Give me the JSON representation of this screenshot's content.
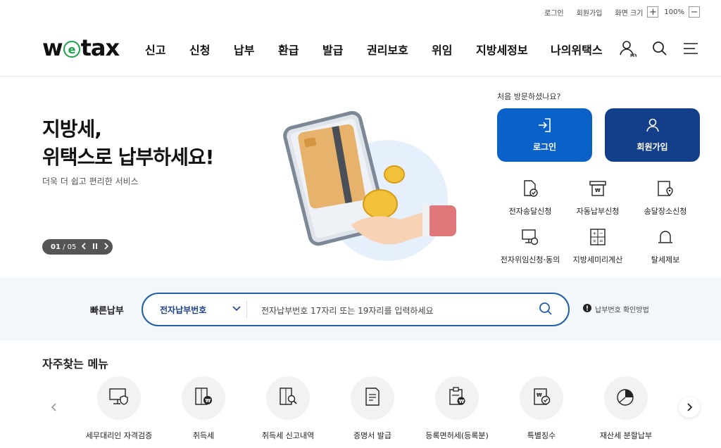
{
  "utility": {
    "login": "로그인",
    "signup": "회원가입",
    "zoom_label": "화면 크기",
    "zoom_in": "+",
    "zoom_value": "100%",
    "zoom_out": "−"
  },
  "logo": {
    "part1": "w",
    "part2": "e",
    "part3": "tax"
  },
  "nav": [
    "신고",
    "신청",
    "납부",
    "환급",
    "발급",
    "권리보호",
    "위임",
    "지방세정보",
    "나의위택스"
  ],
  "header_icons": {
    "my": "MY"
  },
  "hero": {
    "title_line1": "지방세,",
    "title_line2": "위택스로 납부하세요!",
    "subtitle": "더욱 더 쉽고 편리한 서비스",
    "pager_current": "01",
    "pager_total": "/ 05"
  },
  "panel": {
    "first_visit": "처음 방문하셨나요?",
    "login_btn": "로그인",
    "signup_btn": "회원가입",
    "login_color": "#0a62c9",
    "signup_color": "#133e8a",
    "services": [
      {
        "label": "전자송달신청",
        "icon": "document-check-icon"
      },
      {
        "label": "자동납부신청",
        "icon": "auto-pay-icon"
      },
      {
        "label": "송달장소신청",
        "icon": "location-doc-icon"
      },
      {
        "label": "전자위임신청·동의",
        "icon": "monitor-delegate-icon"
      },
      {
        "label": "지방세미리계산",
        "icon": "calculator-icon"
      },
      {
        "label": "탈세제보",
        "icon": "siren-icon"
      }
    ]
  },
  "quick_pay": {
    "label": "빠른납부",
    "select_value": "전자납부번호",
    "placeholder": "전자납부번호 17자리 또는 19자리를 입력하세요",
    "help": "납부번호 확인방법",
    "accent": "#1f5fa6"
  },
  "frequent": {
    "title": "자주찾는 메뉴",
    "items": [
      {
        "label": "세무대리인 자격검증",
        "icon": "monitor-shield-icon"
      },
      {
        "label": "취득세",
        "icon": "building-won-icon"
      },
      {
        "label": "취득세 신고내역",
        "icon": "building-search-icon"
      },
      {
        "label": "증명서 발급",
        "icon": "certificate-icon"
      },
      {
        "label": "등록면허세(등록분)",
        "icon": "clipboard-won-icon"
      },
      {
        "label": "특별징수",
        "icon": "doc-check-won-icon"
      },
      {
        "label": "재산세 분할납부",
        "icon": "pie-chart-icon"
      }
    ]
  }
}
